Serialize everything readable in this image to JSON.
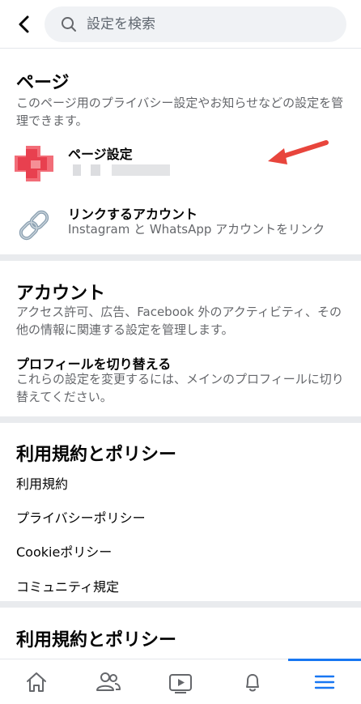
{
  "header": {
    "back_icon": "chevron-left-icon",
    "search_placeholder": "設定を検索",
    "search_icon": "search-icon"
  },
  "page_section": {
    "title": "ページ",
    "description": "このページ用のプライバシー設定やお知らせなどの設定を管理できます。",
    "items": [
      {
        "label": "ページ設定",
        "icon": "page-avatar"
      },
      {
        "label": "リンクするアカウント",
        "sub": "Instagram と WhatsApp アカウントをリンク",
        "icon": "link-icon"
      }
    ]
  },
  "account_section": {
    "title": "アカウント",
    "description": "アクセス許可、広告、Facebook 外のアクティビティ、その他の情報に関連する設定を管理します。",
    "switch_profile": {
      "label": "プロフィールを切り替える",
      "sub": "これらの設定を変更するには、メインのプロフィールに切り替えてください。"
    }
  },
  "terms_section": {
    "title": "利用規約とポリシー",
    "items": [
      "利用規約",
      "プライバシーポリシー",
      "Cookieポリシー",
      "コミュニティ規定"
    ]
  },
  "terms_section_2": {
    "title": "利用規約とポリシー"
  },
  "tabbar": {
    "tabs": [
      {
        "name": "home",
        "icon": "home-icon",
        "active": false
      },
      {
        "name": "friends",
        "icon": "friends-icon",
        "active": false
      },
      {
        "name": "watch",
        "icon": "video-icon",
        "active": false
      },
      {
        "name": "notifications",
        "icon": "bell-icon",
        "active": false
      },
      {
        "name": "menu",
        "icon": "menu-icon",
        "active": true
      }
    ]
  },
  "colors": {
    "accent": "#1877f2",
    "secondary_text": "#65676b",
    "divider": "#e9ebee",
    "annotation_arrow": "#e8453c"
  }
}
